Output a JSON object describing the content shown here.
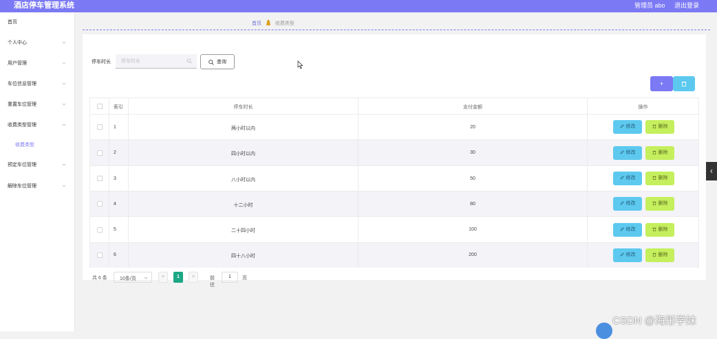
{
  "header": {
    "app_title": "酒店停车管理系统",
    "admin": "管理员 abo",
    "logout": "退出登录"
  },
  "sidebar": {
    "items": [
      {
        "label": "首页",
        "expandable": false
      },
      {
        "label": "个人中心",
        "expandable": true
      },
      {
        "label": "用户管理",
        "expandable": true
      },
      {
        "label": "车位信息管理",
        "expandable": true
      },
      {
        "label": "重置车位管理",
        "expandable": true
      },
      {
        "label": "收费类型管理",
        "expandable": true
      },
      {
        "label": "收费类型",
        "sub": true,
        "active": true
      },
      {
        "label": "预定车位管理",
        "expandable": true
      },
      {
        "label": "解除车位管理",
        "expandable": true
      }
    ]
  },
  "breadcrumb": {
    "home": "首页",
    "current": "收费类型"
  },
  "search": {
    "label": "停车时长",
    "placeholder": "停车时长",
    "button": "查询"
  },
  "toolbar": {
    "add": "+",
    "delete_icon": "trash-icon"
  },
  "table": {
    "headers": {
      "index": "索引",
      "duration": "停车时长",
      "amount": "支付金额",
      "ops": "操作"
    },
    "edit_label": "修改",
    "delete_label": "删除",
    "rows": [
      {
        "index": "1",
        "duration": "两小时以内",
        "amount": "20"
      },
      {
        "index": "2",
        "duration": "四小时以内",
        "amount": "30"
      },
      {
        "index": "3",
        "duration": "八小时以内",
        "amount": "50"
      },
      {
        "index": "4",
        "duration": "十二小时",
        "amount": "80"
      },
      {
        "index": "5",
        "duration": "二十四小时",
        "amount": "100"
      },
      {
        "index": "6",
        "duration": "四十八小时",
        "amount": "200"
      }
    ]
  },
  "pagination": {
    "total": "共 6 条",
    "page_size": "10条/页",
    "prev": "<",
    "current": "1",
    "next": ">",
    "goto_label": "前往",
    "goto_value": "1",
    "page_unit": "页"
  },
  "watermark": "CSDN @海彤学妹",
  "colors": {
    "primary": "#7b79f4",
    "edit": "#5dc9ef",
    "delete": "#c5ef5d",
    "pager_active": "#1ba784"
  }
}
